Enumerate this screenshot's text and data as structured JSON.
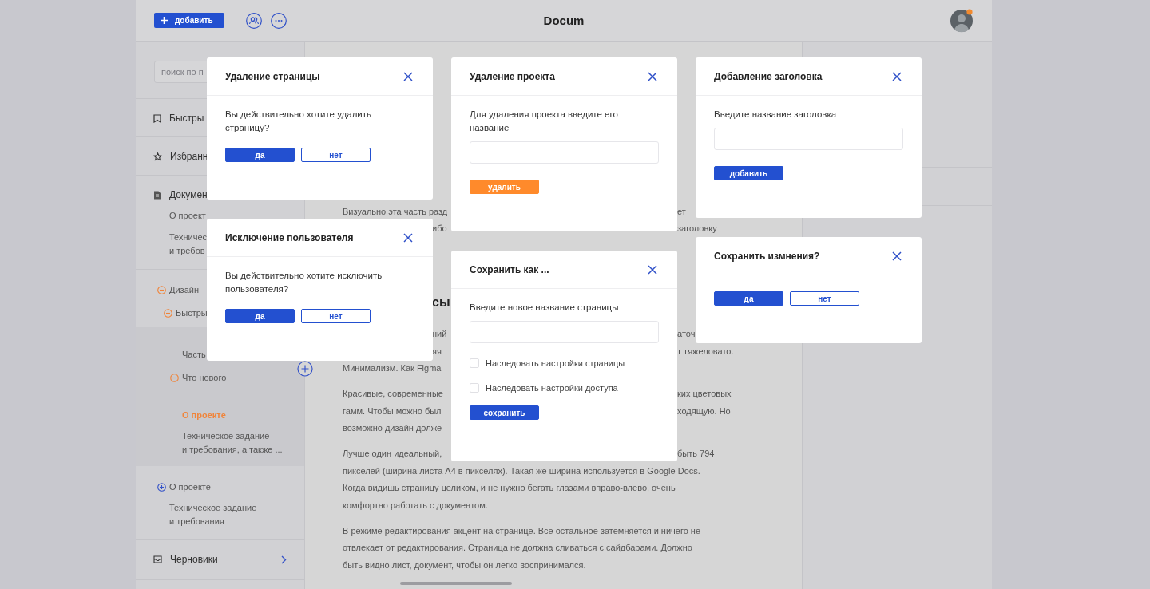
{
  "topbar": {
    "add_button": "добавить",
    "title": "Docum"
  },
  "sidebar": {
    "search": {
      "placeholder": "поиск по п"
    },
    "sections": [
      {
        "kind": "bookmark",
        "label": "Быстры"
      },
      {
        "kind": "star",
        "label": "Избранн"
      },
      {
        "kind": "document",
        "label": "Докумен",
        "children": [
          "О проект",
          "Техничес\nи требов"
        ]
      }
    ],
    "tree": [
      {
        "label": "Дизайн",
        "expanded": true,
        "selected": false,
        "children": [
          {
            "label": "Быстры",
            "expanded": true,
            "selected": false,
            "children": [
              {
                "label": "Часть",
                "selected": false
              },
              {
                "label": "Что нового",
                "expanded": true,
                "selected": false,
                "children": [
                  {
                    "label": "О проекте",
                    "selected": true
                  },
                  {
                    "label": "Техническое задание\nи требования, а также ...",
                    "selected": false
                  }
                ]
              }
            ]
          }
        ]
      },
      {
        "label": "О проекте",
        "expanded": false,
        "selected": false
      },
      {
        "label": "Техническое задание\nи требования",
        "selected": false
      }
    ],
    "drafts": {
      "label": "Черновики"
    }
  },
  "document": {
    "blocks": [
      {
        "kind": "paragraph",
        "lines": [
          {
            "left": "Визуально эта часть разд",
            "right": "ет"
          },
          {
            "tail": "ибо",
            "right": "заголовку"
          }
        ]
      },
      {
        "kind": "heading",
        "tail": "сы"
      },
      {
        "kind": "paragraph",
        "lines": [
          {
            "tail": "ний",
            "right": "аточ"
          },
          {
            "tail": "яя",
            "right": "т тяжеловато."
          },
          {
            "left": "Минимализм. Как Figma"
          }
        ]
      },
      {
        "kind": "paragraph",
        "lines": [
          {
            "left": "Красивые, современные",
            "right": "ких цветовых"
          },
          {
            "left": "гамм. Чтобы можно был",
            "right": "ходящую. Но"
          },
          {
            "left": "возможно дизайн долже"
          }
        ]
      },
      {
        "kind": "paragraph",
        "lines": [
          {
            "left": "Лучше один идеальный,",
            "right": "быть 794"
          },
          {
            "full": "пикселей (ширина листа А4 в пикселях). Такая же ширина используется в Google Docs."
          },
          {
            "full": "Когда видишь страницу целиком, и не нужно бегать глазами вправо-влево, очень"
          },
          {
            "full": "комфортно работать с документом."
          }
        ]
      },
      {
        "kind": "paragraph",
        "lines": [
          {
            "full": "В режиме редактирования акцент на странице. Все остальное затемняется и ничего не"
          },
          {
            "full": "отвлекает от редактирования.  Страница не должна сливаться с сайдбарами. Должно"
          },
          {
            "full": "быть видно лист, документ, чтобы он легко воспринимался."
          }
        ]
      }
    ]
  },
  "dialogs": [
    {
      "title": "Удаление страницы",
      "body": [
        {
          "kind": "text",
          "text": "Вы действительно хотите удалить страницу?"
        },
        {
          "kind": "buttons",
          "buttons": [
            {
              "label": "да",
              "kind": "primary"
            },
            {
              "label": "нет",
              "kind": "outline"
            }
          ]
        }
      ]
    },
    {
      "title": "Удаление проекта",
      "body": [
        {
          "kind": "text",
          "text": "Для удаления проекта введите его название"
        },
        {
          "kind": "input"
        },
        {
          "kind": "buttons",
          "buttons": [
            {
              "label": "удалить",
              "kind": "danger"
            }
          ]
        }
      ]
    },
    {
      "title": "Добавление заголовка",
      "body": [
        {
          "kind": "text",
          "text": "Введите название заголовка"
        },
        {
          "kind": "input"
        },
        {
          "kind": "buttons",
          "buttons": [
            {
              "label": "добавить",
              "kind": "primary"
            }
          ]
        }
      ]
    },
    {
      "title": "Исключение пользователя",
      "body": [
        {
          "kind": "text",
          "text": "Вы действительно хотите исключить пользователя?"
        },
        {
          "kind": "buttons",
          "buttons": [
            {
              "label": "да",
              "kind": "primary"
            },
            {
              "label": "нет",
              "kind": "outline"
            }
          ]
        }
      ]
    },
    {
      "title": "Сохранить как ...",
      "body": [
        {
          "kind": "text",
          "text": "Введите новое название страницы"
        },
        {
          "kind": "input"
        },
        {
          "kind": "checkbox",
          "label": "Наследовать настройки страницы",
          "checked": false
        },
        {
          "kind": "checkbox",
          "label": "Наследовать настройки доступа",
          "checked": false
        },
        {
          "kind": "buttons",
          "buttons": [
            {
              "label": "сохранить",
              "kind": "primary"
            }
          ]
        }
      ]
    },
    {
      "title": "Сохранить измнения?",
      "body": [
        {
          "kind": "buttons",
          "buttons": [
            {
              "label": "да",
              "kind": "primary"
            },
            {
              "label": "нет",
              "kind": "outline"
            }
          ]
        }
      ]
    }
  ]
}
